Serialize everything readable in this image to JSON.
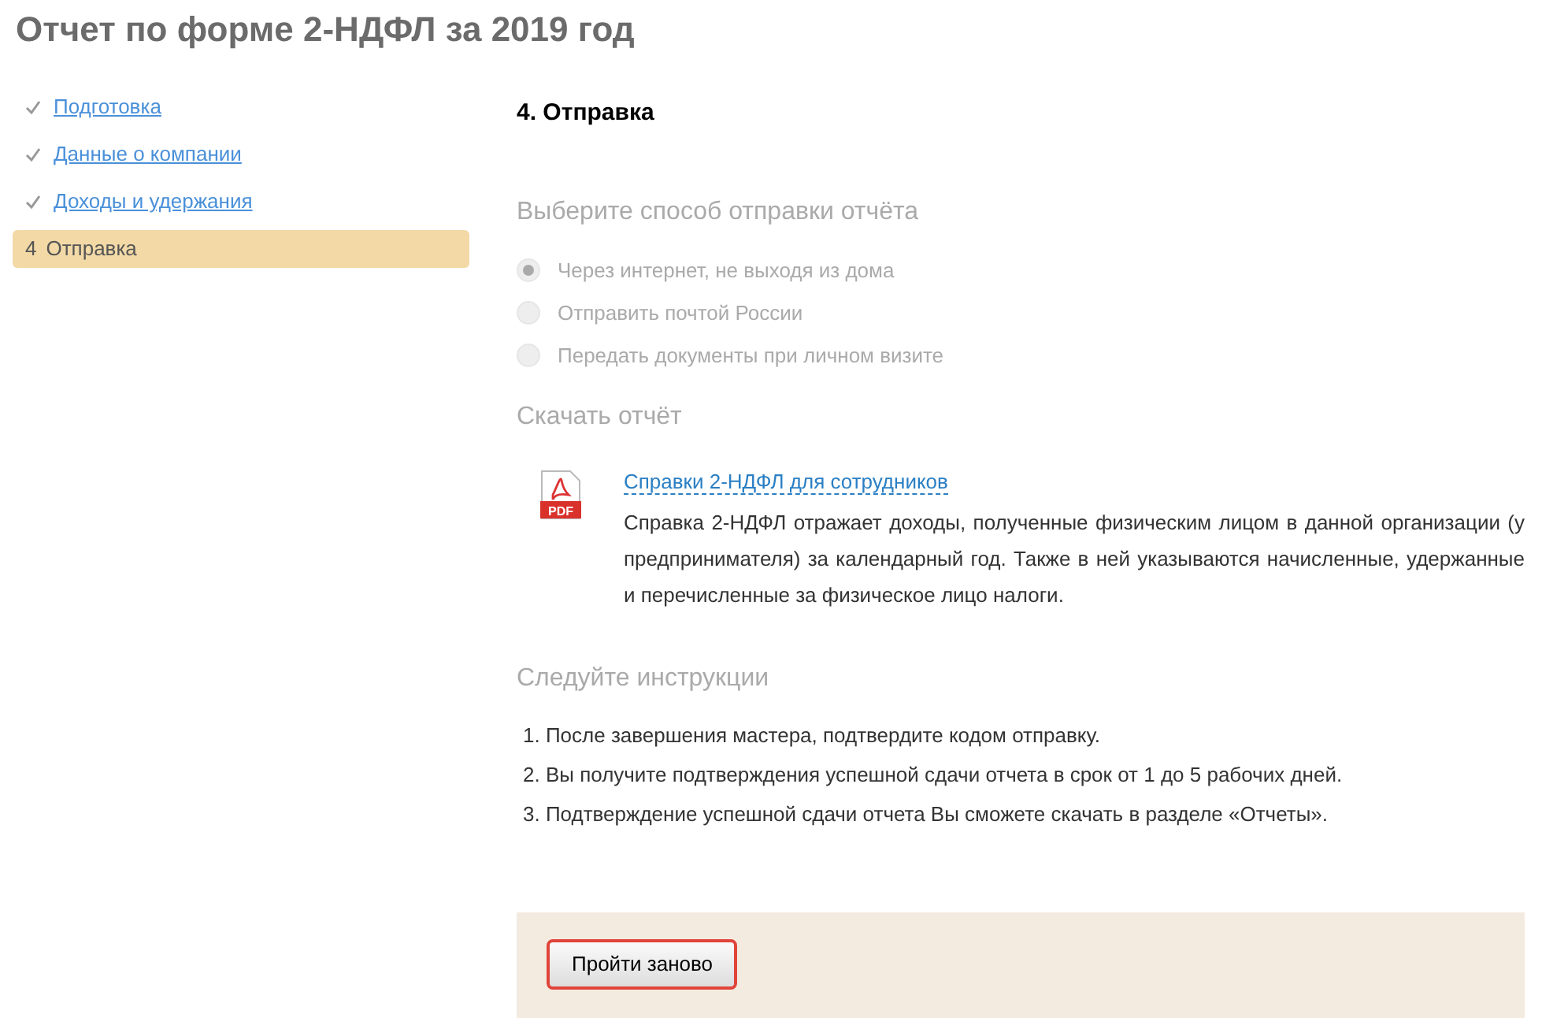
{
  "page_title": "Отчет по форме 2-НДФЛ за 2019 год",
  "steps": [
    {
      "label": "Подготовка",
      "done": true,
      "selected": false
    },
    {
      "label": "Данные о компании",
      "done": true,
      "selected": false
    },
    {
      "label": "Доходы и удержания",
      "done": true,
      "selected": false
    },
    {
      "number": "4",
      "label": "Отправка",
      "done": false,
      "selected": true
    }
  ],
  "step_title": "4. Отправка",
  "send_method": {
    "heading": "Выберите способ отправки отчёта",
    "options": [
      {
        "label": "Через интернет, не выходя из дома",
        "checked": true,
        "disabled": true
      },
      {
        "label": "Отправить почтой России",
        "checked": false,
        "disabled": true
      },
      {
        "label": "Передать документы при личном визите",
        "checked": false,
        "disabled": true
      }
    ]
  },
  "download": {
    "heading": "Скачать отчёт",
    "file_badge": "PDF",
    "link": "Справки 2-НДФЛ для сотрудников",
    "description": "Справка 2-НДФЛ отражает доходы, полученные физическим лицом в данной организации (у предпринимателя) за календарный год. Также в ней указываются начисленные, удержанные и перечисленные за физическое лицо налоги."
  },
  "instructions": {
    "heading": "Следуйте инструкции",
    "items": [
      {
        "number": "1.",
        "text": "После завершения мастера, подтвердите кодом отправку."
      },
      {
        "number": "2.",
        "text": "Вы получите подтверждения успешной сдачи отчета в срок от 1 до 5 рабочих дней."
      },
      {
        "number": "3.",
        "text": "Подтверждение успешной сдачи отчета Вы сможете скачать в разделе «Отчеты»."
      }
    ]
  },
  "footer_button": "Пройти заново"
}
